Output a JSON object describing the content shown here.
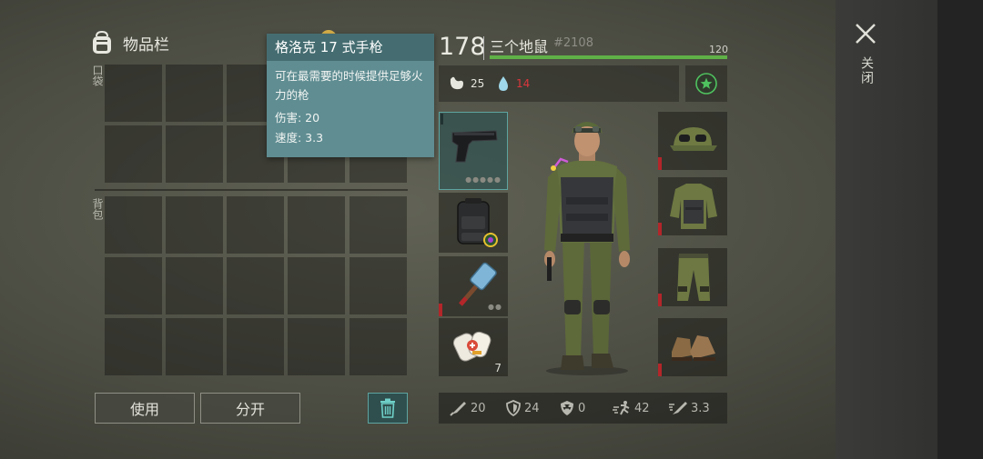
{
  "inventory": {
    "title": "物品栏",
    "pocket_label": "口袋",
    "backpack_label": "背包",
    "use_button": "使用",
    "split_button": "分开"
  },
  "tooltip": {
    "title": "格洛克 17 式手枪",
    "description": "可在最需要的时候提供足够火力的枪",
    "damage": "伤害: 20",
    "speed": "速度: 3.3"
  },
  "player": {
    "level": "178",
    "name": "三个地鼠",
    "id": "#2108",
    "xp_label": "120",
    "xp_fraction": 1.0
  },
  "needs": {
    "food": "25",
    "water": "14"
  },
  "equipment": {
    "medkit_qty": "7"
  },
  "stats": {
    "damage": "20",
    "defense": "24",
    "radiation": "0",
    "speed": "42",
    "attack_speed": "3.3"
  },
  "close": {
    "label": "关闭"
  },
  "colors": {
    "accent_teal": "#5ea4a0",
    "xp_green": "#5fb147",
    "water_red": "#d9363c",
    "durability_red": "#b3262a"
  }
}
